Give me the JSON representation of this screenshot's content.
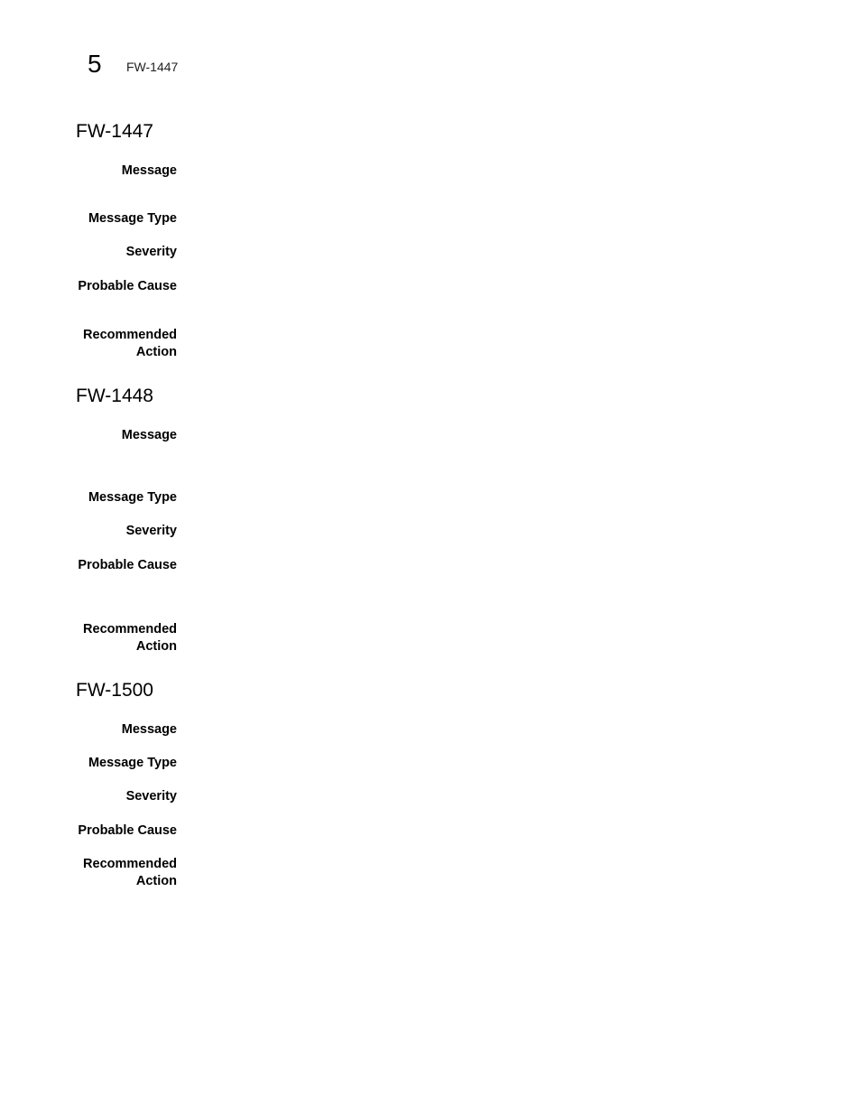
{
  "header": {
    "chapter_number": "5",
    "running_title": "FW-1447"
  },
  "field_labels": {
    "message": "Message",
    "message_type": "Message Type",
    "severity": "Severity",
    "probable_cause": "Probable Cause",
    "recommended_action_line1": "Recommended",
    "recommended_action_line2": "Action"
  },
  "sections": [
    {
      "title": "FW-1447"
    },
    {
      "title": "FW-1448"
    },
    {
      "title": "FW-1500"
    }
  ]
}
